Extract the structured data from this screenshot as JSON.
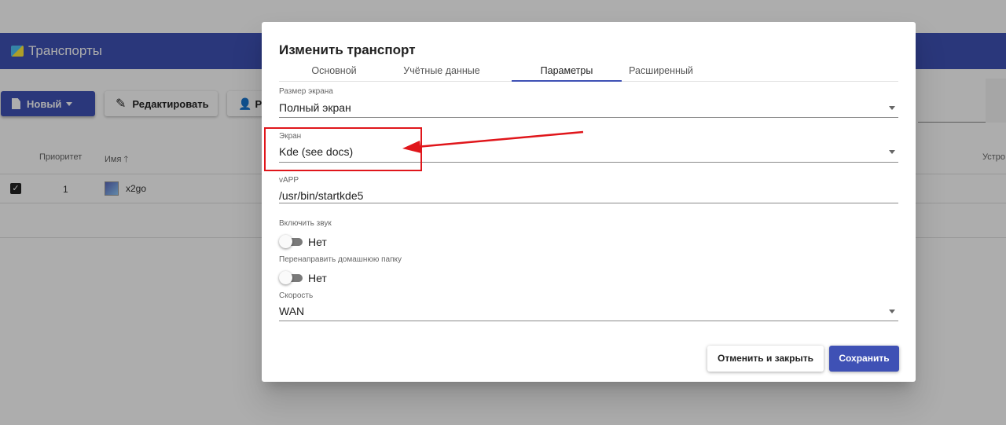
{
  "app": {
    "title": "Транспорты"
  },
  "toolbar": {
    "new_label": "Новый",
    "edit_label": "Редактировать",
    "perm_label": "Р"
  },
  "table": {
    "headers": {
      "priority": "Приоритет",
      "name": "Имя",
      "device": "Устро"
    },
    "rows": [
      {
        "priority": "1",
        "name": "x2go",
        "checked": true
      }
    ]
  },
  "dialog": {
    "title": "Изменить транспорт",
    "tabs": [
      "Основной",
      "Учётные данные",
      "Параметры",
      "Расширенный"
    ],
    "active_tab": "Параметры",
    "fields": {
      "screen_size": {
        "label": "Размер экрана",
        "value": "Полный экран"
      },
      "desktop": {
        "label": "Экран",
        "value": "Kde (see docs)"
      },
      "vapp": {
        "label": "vAPP",
        "value": "/usr/bin/startkde5"
      },
      "sound": {
        "label": "Включить звук",
        "value": "Нет",
        "on": false
      },
      "redirect_home": {
        "label": "Перенаправить домашнюю папку",
        "value": "Нет",
        "on": false
      },
      "speed": {
        "label": "Скорость",
        "value": "WAN"
      }
    },
    "cancel_label": "Отменить и закрыть",
    "save_label": "Сохранить"
  },
  "colors": {
    "primary": "#3f51b5",
    "annotation": "#e0161b"
  }
}
